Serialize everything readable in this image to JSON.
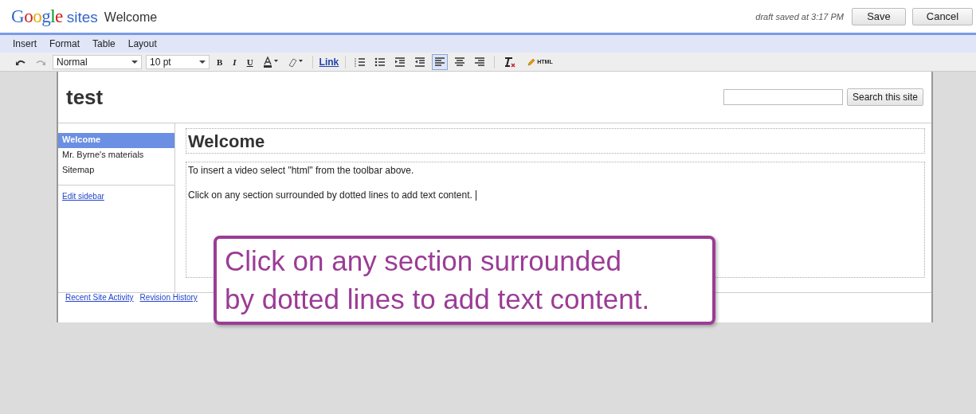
{
  "header": {
    "logo_google": "Google",
    "logo_sites": "sites",
    "page_title": "Welcome",
    "draft_status": "draft saved at 3:17 PM",
    "buttons": [
      "Save",
      "Cancel"
    ]
  },
  "menu": [
    "Insert",
    "Format",
    "Table",
    "Layout"
  ],
  "toolbar": {
    "style": "Normal",
    "size": "10 pt",
    "format_buttons": [
      "B",
      "I",
      "U"
    ],
    "link": "Link",
    "align_buttons": [
      {
        "selected": true
      },
      {
        "selected": false
      },
      {
        "selected": false
      }
    ],
    "html_label": "HTML"
  },
  "site": {
    "title": "test",
    "search_button": "Search this site"
  },
  "sidebar": {
    "items": [
      {
        "label": "Welcome",
        "selected": true
      },
      {
        "label": "Mr. Byrne's materials",
        "selected": false
      },
      {
        "label": "Sitemap",
        "selected": false
      }
    ],
    "edit_link": "Edit sidebar"
  },
  "content": {
    "heading": "Welcome",
    "paragraphs": [
      "To insert a video select \"html\" from the toolbar above.",
      "Click on any section surrounded by dotted lines to add text content."
    ]
  },
  "footer_links": [
    "Recent Site Activity",
    "Revision History"
  ],
  "callout": "Click on any section surrounded by dotted lines to add text content."
}
